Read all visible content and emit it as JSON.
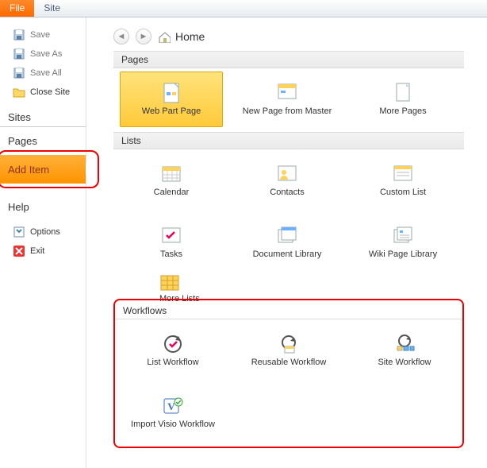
{
  "ribbon": {
    "file": "File",
    "site": "Site"
  },
  "sidebar": {
    "save": "Save",
    "save_as": "Save As",
    "save_all": "Save All",
    "close_site": "Close Site",
    "sites_hd": "Sites",
    "pages_link": "Pages",
    "add_item": "Add Item",
    "help_link": "Help",
    "options": "Options",
    "exit": "Exit"
  },
  "crumb": {
    "home": "Home"
  },
  "sections": {
    "pages": {
      "header": "Pages",
      "tiles": [
        {
          "label": "Web Part Page",
          "selected": true
        },
        {
          "label": "New Page from Master"
        },
        {
          "label": "More Pages"
        }
      ]
    },
    "lists": {
      "header": "Lists",
      "tiles": [
        {
          "label": "Calendar"
        },
        {
          "label": "Contacts"
        },
        {
          "label": "Custom List"
        },
        {
          "label": "Tasks"
        },
        {
          "label": "Document Library"
        },
        {
          "label": "Wiki Page Library"
        }
      ],
      "more": "More Lists"
    },
    "workflows": {
      "header": "Workflows",
      "tiles": [
        {
          "label": "List Workflow"
        },
        {
          "label": "Reusable Workflow"
        },
        {
          "label": "Site Workflow"
        },
        {
          "label": "Import Visio Workflow"
        }
      ]
    }
  }
}
